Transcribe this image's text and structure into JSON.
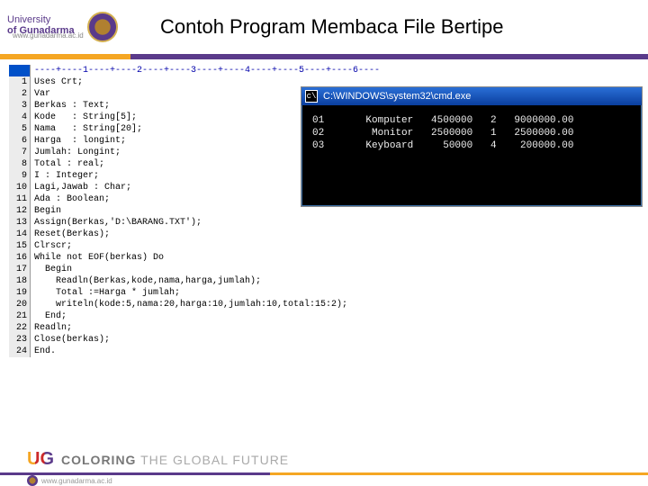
{
  "header": {
    "university_line1": "University",
    "university_line2": "of Gunadarma",
    "url": "www.gunadarma.ac.id",
    "title": "Contoh Program Membaca File Bertipe"
  },
  "editor": {
    "ruler": "----+----1----+----2----+----3----+----4----+----5----+----6----",
    "lines": [
      "Uses Crt;",
      "Var",
      "Berkas : Text;",
      "Kode   : String[5];",
      "Nama   : String[20];",
      "Harga  : longint;",
      "Jumlah: Longint;",
      "Total : real;",
      "I : Integer;",
      "Lagi,Jawab : Char;",
      "Ada : Boolean;",
      "Begin",
      "Assign(Berkas,'D:\\BARANG.TXT');",
      "Reset(Berkas);",
      "Clrscr;",
      "While not EOF(berkas) Do",
      "  Begin",
      "    Readln(Berkas,kode,nama,harga,jumlah);",
      "    Total :=Harga * jumlah;",
      "    writeln(kode:5,nama:20,harga:10,jumlah:10,total:15:2);",
      "  End;",
      "Readln;",
      "Close(berkas);",
      "End."
    ]
  },
  "console": {
    "title": "C:\\WINDOWS\\system32\\cmd.exe",
    "icon_glyph": "c\\",
    "rows": [
      {
        "c1": "01",
        "c2": "Komputer",
        "c3": "4500000",
        "c4": "2",
        "c5": "9000000.00"
      },
      {
        "c1": "02",
        "c2": "Monitor",
        "c3": "2500000",
        "c4": "1",
        "c5": "2500000.00"
      },
      {
        "c1": "03",
        "c2": "Keyboard",
        "c3": "50000",
        "c4": "4",
        "c5": "200000.00"
      }
    ]
  },
  "footer": {
    "badge": "UG",
    "tagline_light": "COLORING",
    "tagline_rest": " THE GLOBAL FUTURE",
    "url": "www.gunadarma.ac.id"
  }
}
